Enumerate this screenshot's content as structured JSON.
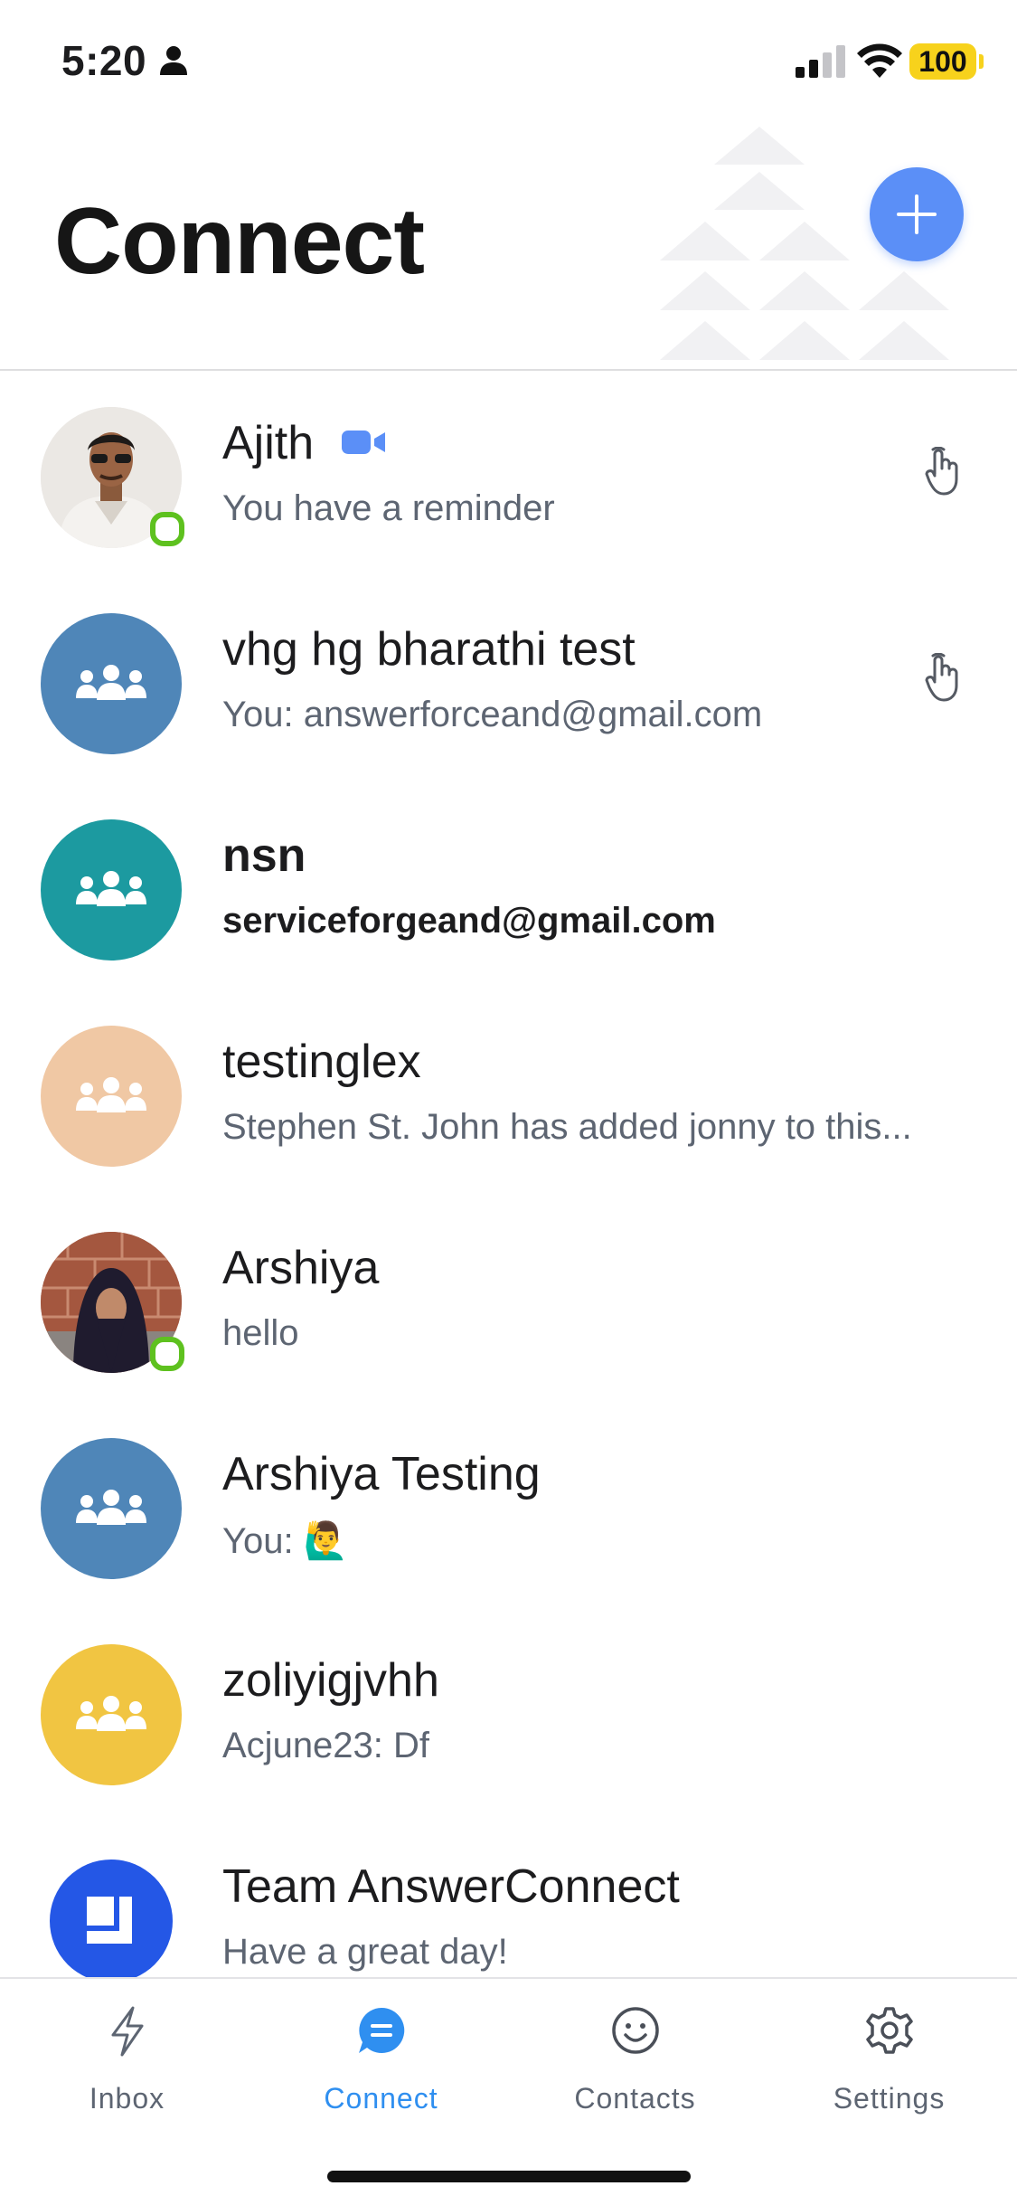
{
  "status_bar": {
    "time": "5:20",
    "battery": "100"
  },
  "header": {
    "title": "Connect"
  },
  "conversations": [
    {
      "name": "Ajith",
      "preview": "You have a reminder",
      "avatar": "photo-man",
      "online": true,
      "video": true,
      "wave": true
    },
    {
      "name": "vhg hg bharathi test",
      "preview": "You: answerforceand@gmail.com",
      "avatar_color": "#4f86b8",
      "wave": true
    },
    {
      "name": "nsn",
      "preview": "serviceforgeand@gmail.com",
      "avatar_color": "#1c9aa0",
      "unread": true
    },
    {
      "name": "testinglex",
      "preview": "Stephen St. John has added jonny to this...",
      "avatar_color": "#f0c8a4"
    },
    {
      "name": "Arshiya",
      "preview": "hello",
      "avatar": "photo-woman",
      "online": true
    },
    {
      "name": "Arshiya Testing",
      "preview": "You: 🙋‍♂️",
      "avatar_color": "#4f86b8"
    },
    {
      "name": "zoliyigjvhh",
      "preview": "Acjune23: Df",
      "avatar_color": "#f1c542"
    },
    {
      "name": "Team AnswerConnect",
      "preview": "Have a great day!",
      "avatar_color": "#2457e6"
    }
  ],
  "tabs": [
    {
      "label": "Inbox",
      "icon": "bolt-icon"
    },
    {
      "label": "Connect",
      "icon": "chat-bubble-icon",
      "active": true
    },
    {
      "label": "Contacts",
      "icon": "smiley-icon"
    },
    {
      "label": "Settings",
      "icon": "gear-icon"
    }
  ],
  "colors": {
    "accent": "#2f8ff0",
    "add_button": "#5b8ff7",
    "online": "#5ec11f"
  }
}
